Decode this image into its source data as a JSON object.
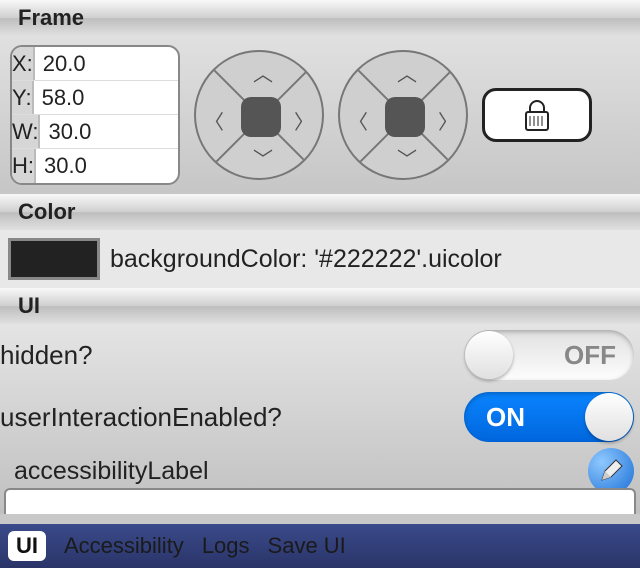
{
  "sections": {
    "frame": {
      "title": "Frame",
      "coords": {
        "x_label": "X:",
        "x_value": "20.0",
        "y_label": "Y:",
        "y_value": "58.0",
        "w_label": "W:",
        "w_value": "30.0",
        "h_label": "H:",
        "h_value": "30.0"
      }
    },
    "color": {
      "title": "Color",
      "swatch_hex": "#222222",
      "text": "backgroundColor: '#222222'.uicolor"
    },
    "ui": {
      "title": "UI",
      "hidden_label": "hidden?",
      "hidden_state": "OFF",
      "interaction_label": "userInteractionEnabled?",
      "interaction_state": "ON",
      "accessibility_label": "accessibilityLabel"
    }
  },
  "tabbar": {
    "items": [
      "UI",
      "Accessibility",
      "Logs",
      "Save UI"
    ],
    "active": "UI"
  }
}
